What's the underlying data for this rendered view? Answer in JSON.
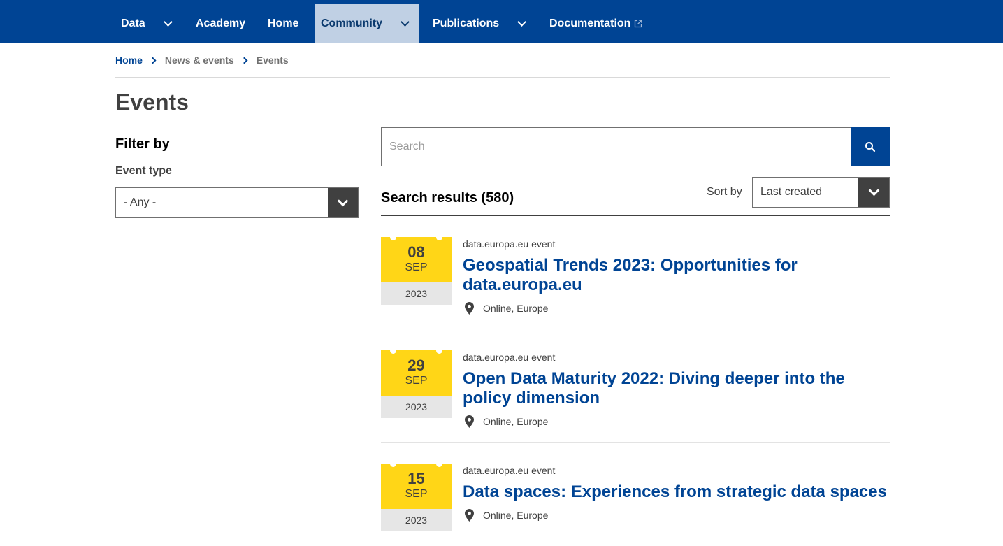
{
  "nav": {
    "items": [
      {
        "label": "Data",
        "has_dropdown": true,
        "active": false
      },
      {
        "label": "Academy",
        "has_dropdown": false,
        "active": false
      },
      {
        "label": "Home",
        "has_dropdown": false,
        "active": false
      },
      {
        "label": "Community",
        "has_dropdown": true,
        "active": true
      },
      {
        "label": "Publications",
        "has_dropdown": true,
        "active": false
      },
      {
        "label": "Documentation",
        "has_dropdown": false,
        "external": true,
        "active": false
      }
    ]
  },
  "breadcrumb": [
    {
      "label": "Home"
    },
    {
      "label": "News & events"
    },
    {
      "label": "Events"
    }
  ],
  "page_title": "Events",
  "filter": {
    "title": "Filter by",
    "event_type_label": "Event type",
    "event_type_value": "- Any -"
  },
  "search": {
    "placeholder": "Search",
    "value": "",
    "icon": "search-icon"
  },
  "results": {
    "title": "Search results (580)",
    "sort_label": "Sort by",
    "sort_value": "Last created"
  },
  "events": [
    {
      "day": "08",
      "month": "SEP",
      "year": "2023",
      "type": "data.europa.eu event",
      "title": "Geospatial Trends 2023: Opportunities for data.europa.eu",
      "location": "Online, Europe"
    },
    {
      "day": "29",
      "month": "SEP",
      "year": "2023",
      "type": "data.europa.eu event",
      "title": "Open Data Maturity 2022: Diving deeper into the policy dimension",
      "location": "Online, Europe"
    },
    {
      "day": "15",
      "month": "SEP",
      "year": "2023",
      "type": "data.europa.eu event",
      "title": "Data spaces: Experiences from strategic data spaces",
      "location": "Online, Europe"
    }
  ],
  "colors": {
    "brand_blue": "#004494",
    "nav_active_bg": "#c0d0e4",
    "date_yellow": "#ffd617",
    "dark_grey": "#404040"
  }
}
